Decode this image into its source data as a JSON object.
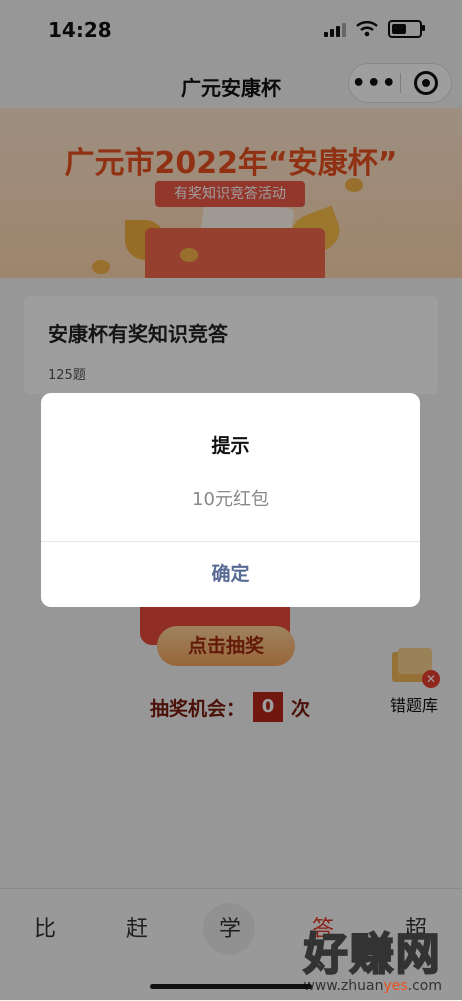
{
  "status_bar": {
    "time": "14:28",
    "battery_level": 0.45
  },
  "nav": {
    "title": "广元安康杯",
    "more_glyph": "•••"
  },
  "banner": {
    "title": "广元市2022年“安康杯”",
    "subtitle": "有奖知识竞答活动"
  },
  "quiz_card": {
    "title": "安康杯有奖知识竞答",
    "count": "125题"
  },
  "lottery": {
    "button_label": "点击抽奖",
    "chance_prefix": "抽奖机会：",
    "chance_count": "0",
    "chance_suffix": "次"
  },
  "wrong_bank": {
    "label": "错题库"
  },
  "tabs": [
    {
      "label": "比"
    },
    {
      "label": "赶"
    },
    {
      "label": "学"
    },
    {
      "label": "答"
    },
    {
      "label": "超"
    }
  ],
  "dialog": {
    "title": "提示",
    "message": "10元红包",
    "confirm_label": "确定"
  },
  "watermark": {
    "text": "好赚网",
    "url_prefix": "www.zhuan",
    "url_highlight": "yes",
    "url_suffix": ".com"
  },
  "colors": {
    "accent_red": "#e03a2b",
    "dialog_link": "#576b95",
    "banner_orange": "#e8501f"
  }
}
